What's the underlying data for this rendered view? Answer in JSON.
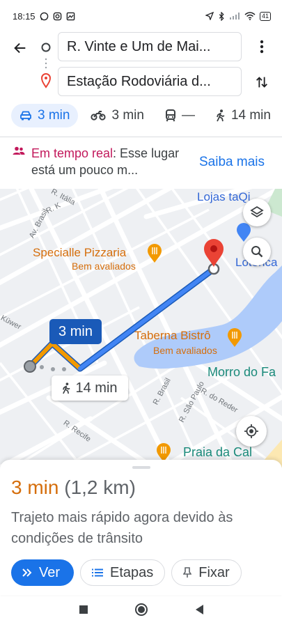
{
  "status_bar": {
    "time": "18:15",
    "left_icons": [
      "whatsapp-icon",
      "instagram-icon",
      "gallery-icon"
    ],
    "right_icons": [
      "location-arrow-icon",
      "bluetooth-icon",
      "signal-icon",
      "wifi-icon"
    ],
    "battery": "41"
  },
  "search": {
    "origin": "R. Vinte e Um de Mai...",
    "destination": "Estação Rodoviária d..."
  },
  "modes": [
    {
      "name": "car",
      "label": "3 min",
      "active": true
    },
    {
      "name": "motorcycle",
      "label": "3 min",
      "active": false
    },
    {
      "name": "transit",
      "label": "—",
      "active": false
    },
    {
      "name": "walk",
      "label": "14 min",
      "active": false
    }
  ],
  "traffic": {
    "highlight": "Em tempo real",
    "rest": ": Esse lugar está um pouco m...",
    "link": "Saiba mais"
  },
  "map": {
    "labels": {
      "specialle": "Specialle Pizzaria",
      "specialle_sub": "Bem avaliados",
      "taberna": "Taberna Bistrô",
      "taberna_sub": "Bem avaliados",
      "lojas": "Lojas taQi",
      "lotérica": "Lotérica",
      "morro": "Morro do Fa",
      "praia": "Praia da Cal",
      "street_italia": "R. Itália",
      "street_rk": "R. K",
      "street_brasil_av": "Av. Brasil",
      "street_kuwer": "Küwer",
      "street_recife": "R. Recife",
      "street_brasil": "R. Brasil",
      "street_saopaulo": "R. São Paulo",
      "street_reder": "R. do Reder"
    },
    "eta_bubble": "3 min",
    "walk_bubble": "14 min"
  },
  "sheet": {
    "time": "3 min",
    "distance": "(1,2 km)",
    "description": "Trajeto mais rápido agora devido às condições de trânsito",
    "buttons": {
      "ver": "Ver",
      "etapas": "Etapas",
      "fixar": "Fixar"
    }
  },
  "colors": {
    "accent": "#1a73e8",
    "route": "#4285f4",
    "eta_orange": "#d56e0c",
    "realtime_pink": "#c2185b",
    "water": "#aecbfa"
  }
}
